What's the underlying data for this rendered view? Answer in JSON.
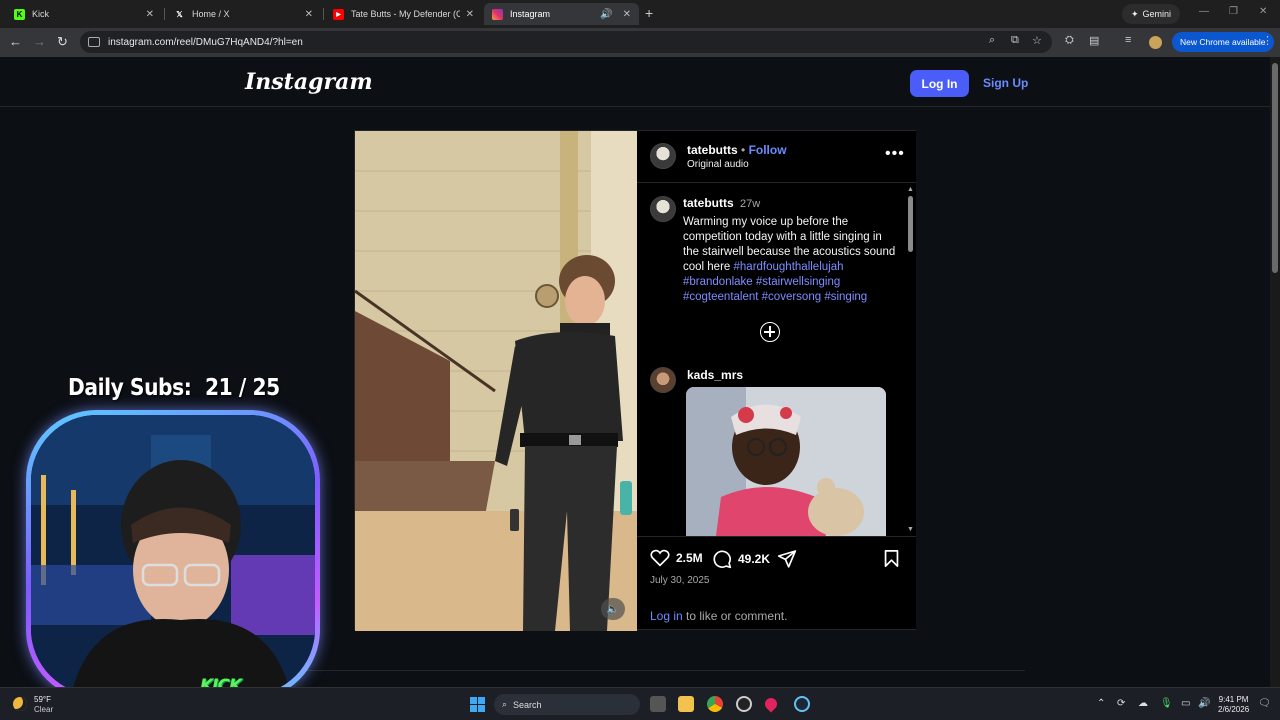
{
  "browser": {
    "tabs": [
      {
        "label": "Kick",
        "favicon": "kick-logo",
        "active": false
      },
      {
        "label": "Home / X",
        "favicon": "x-logo",
        "active": false
      },
      {
        "label": "Tate Butts - My Defender (Offic",
        "favicon": "youtube-logo",
        "active": false
      },
      {
        "label": "Instagram",
        "favicon": "instagram-logo",
        "active": true
      }
    ],
    "gemini_label": "Gemini",
    "url": "instagram.com/reel/DMuG7HqAND4/?hl=en",
    "new_chrome_label": "New Chrome available"
  },
  "instagram": {
    "logo": "Instagram",
    "login_label": "Log In",
    "signup_label": "Sign Up",
    "post": {
      "username": "tatebutts",
      "follow_label": "Follow",
      "separator": "•",
      "audio": "Original audio",
      "caption_user": "tatebutts",
      "caption_age": "27w",
      "caption_text": "Warming my voice up before the competition today with a little singing in the stairwell because the acoustics sound cool here",
      "hashtags": [
        "#hardfoughthallelujah",
        "#brandonlake",
        "#stairwellsinging",
        "#cogteentalent",
        "#coversong",
        "#singing"
      ],
      "comment_user": "kads_mrs",
      "likes": "2.5M",
      "comments": "49.2K",
      "date": "July 30, 2025",
      "login_link": "Log in",
      "login_suffix": "to like or comment."
    }
  },
  "overlay": {
    "daily_subs_label": "Daily Subs:",
    "daily_subs_value": "21 / 25",
    "watermark": "KICK"
  },
  "taskbar": {
    "temperature": "59°F",
    "condition": "Clear",
    "search_placeholder": "Search",
    "time": "9:41 PM",
    "date": "2/6/2026"
  },
  "colors": {
    "ig_accent": "#4a5df9",
    "link_blue": "#6b8cff",
    "chrome_update": "#0b57d0"
  }
}
